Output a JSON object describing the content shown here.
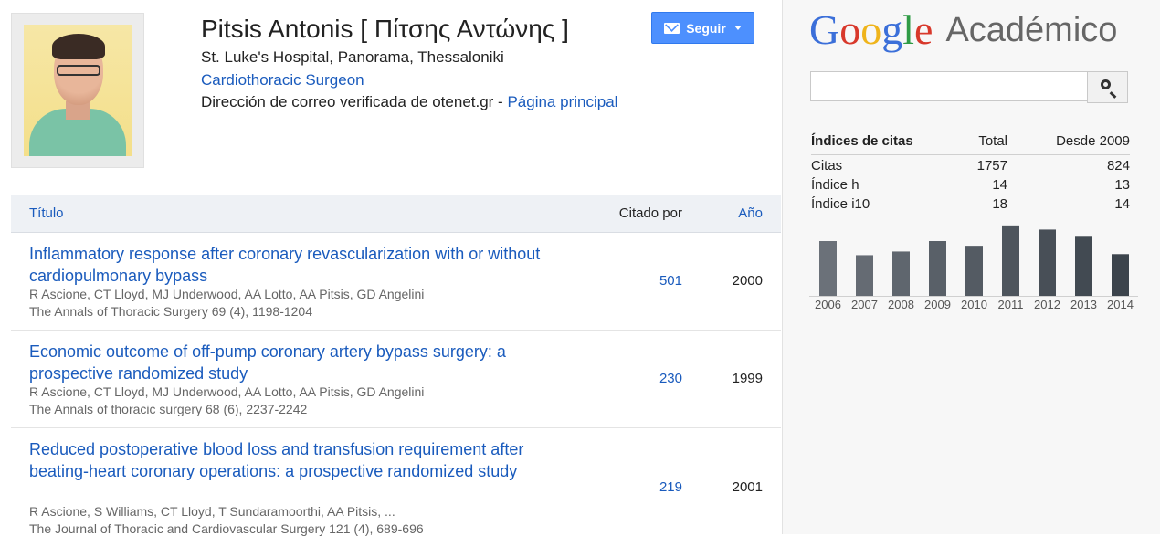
{
  "profile": {
    "name": "Pitsis Antonis [ Πίτσης Αντώνης ]",
    "affiliation": "St. Luke's Hospital, Panorama, Thessaloniki",
    "interest": "Cardiothoracic Surgeon",
    "email_text": "Dirección de correo verificada de otenet.gr - ",
    "homepage_link": "Página principal",
    "follow_label": "Seguir"
  },
  "table": {
    "headers": {
      "title": "Título",
      "cited_by": "Citado por",
      "year": "Año"
    },
    "rows": [
      {
        "title": "Inflammatory response after coronary revascularization with or without cardiopulmonary bypass",
        "authors": "R Ascione, CT Lloyd, MJ Underwood, AA Lotto, AA Pitsis, GD Angelini",
        "venue": "The Annals of Thoracic Surgery 69 (4), 1198-1204",
        "cited_by": "501",
        "year": "2000"
      },
      {
        "title": "Economic outcome of off-pump coronary artery bypass surgery: a prospective randomized study",
        "authors": "R Ascione, CT Lloyd, MJ Underwood, AA Lotto, AA Pitsis, GD Angelini",
        "venue": "The Annals of thoracic surgery 68 (6), 2237-2242",
        "cited_by": "230",
        "year": "1999"
      },
      {
        "title": "Reduced postoperative blood loss and transfusion requirement after beating-heart coronary operations: a prospective randomized study",
        "authors": "R Ascione, S Williams, CT Lloyd, T Sundaramoorthi, AA Pitsis, ...",
        "venue": "The Journal of Thoracic and Cardiovascular Surgery 121 (4), 689-696",
        "cited_by": "219",
        "year": "2001"
      }
    ]
  },
  "logo": {
    "google": [
      "G",
      "o",
      "o",
      "g",
      "l",
      "e"
    ],
    "scholar": "Académico"
  },
  "search": {
    "value": ""
  },
  "stats": {
    "headers": [
      "Índices de citas",
      "Total",
      "Desde 2009"
    ],
    "rows": [
      [
        "Citas",
        "1757",
        "824"
      ],
      [
        "Índice h",
        "14",
        "13"
      ],
      [
        "Índice i10",
        "18",
        "14"
      ]
    ]
  },
  "chart_data": {
    "type": "bar",
    "categories": [
      "2006",
      "2007",
      "2008",
      "2009",
      "2010",
      "2011",
      "2012",
      "2013",
      "2014"
    ],
    "values": [
      105,
      78,
      85,
      105,
      96,
      135,
      127,
      115,
      80
    ],
    "ylim": [
      0,
      140
    ],
    "colors": {
      "bar_light": "#6b7179",
      "bar_dark": "#3c444c"
    }
  }
}
